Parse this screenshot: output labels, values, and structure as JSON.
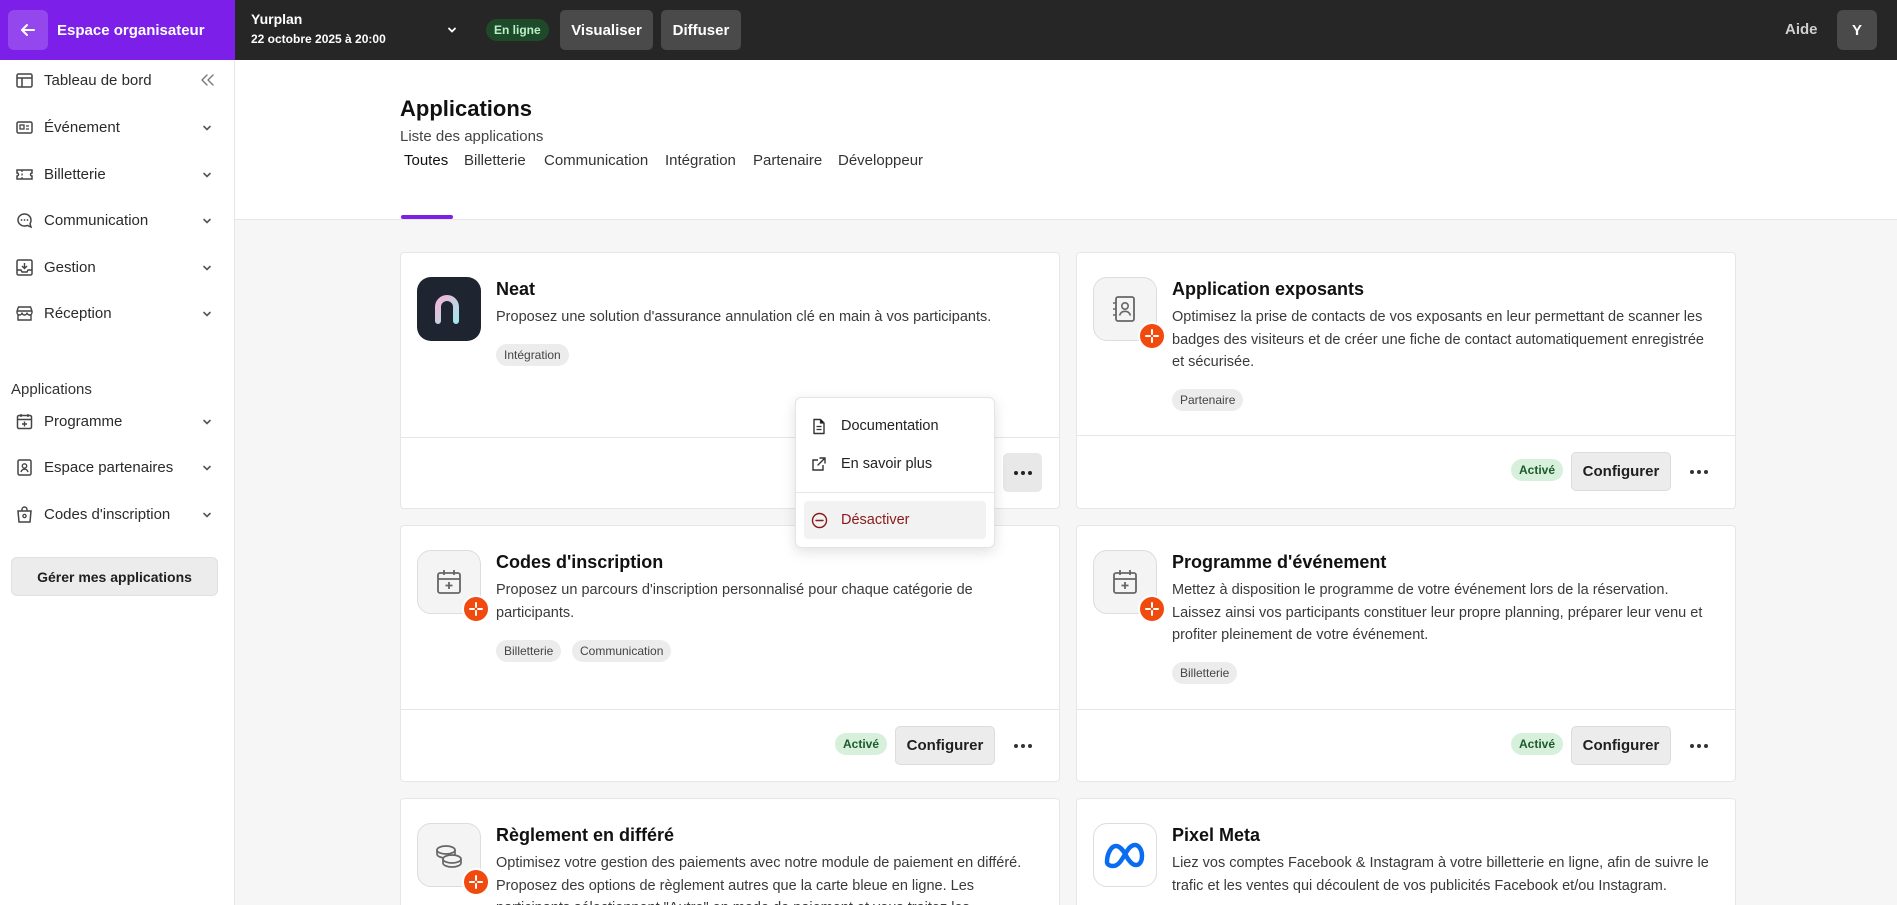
{
  "topbar": {
    "org_label": "Espace organisateur",
    "event_name": "Yurplan",
    "event_date": "22 octobre 2025 à 20:00",
    "status": "En ligne",
    "visualize": "Visualiser",
    "broadcast": "Diffuser",
    "help": "Aide",
    "avatar": "Y"
  },
  "sidebar": {
    "items": [
      {
        "label": "Tableau de bord",
        "icon": "dashboard-icon"
      },
      {
        "label": "Événement",
        "icon": "event-card-icon"
      },
      {
        "label": "Billetterie",
        "icon": "ticket-icon"
      },
      {
        "label": "Communication",
        "icon": "chat-icon"
      },
      {
        "label": "Gestion",
        "icon": "inbox-icon"
      },
      {
        "label": "Réception",
        "icon": "store-icon"
      }
    ],
    "section_title": "Applications",
    "app_items": [
      {
        "label": "Programme",
        "icon": "calendar-plus-icon"
      },
      {
        "label": "Espace partenaires",
        "icon": "contact-badge-icon"
      },
      {
        "label": "Codes d'inscription",
        "icon": "lock-bag-icon"
      }
    ],
    "manage_button": "Gérer mes applications"
  },
  "header": {
    "title": "Applications",
    "subtitle": "Liste des applications",
    "tabs": [
      "Toutes",
      "Billetterie",
      "Communication",
      "Intégration",
      "Partenaire",
      "Développeur"
    ],
    "active_tab": "Toutes"
  },
  "cards": [
    {
      "title": "Neat",
      "description": "Proposez une solution d'assurance annulation clé en main à vos participants.",
      "tags": [
        "Intégration"
      ]
    },
    {
      "title": "Application exposants",
      "description": "Optimisez la prise de contacts de vos exposants en leur permettant de scanner les badges des visiteurs et de créer une fiche de contact automatiquement enregistrée et sécurisée.",
      "tags": [
        "Partenaire"
      ],
      "status": "Activé",
      "configure": "Configurer"
    },
    {
      "title": "Codes d'inscription",
      "description": "Proposez un parcours d'inscription personnalisé pour chaque catégorie de participants.",
      "tags": [
        "Billetterie",
        "Communication"
      ],
      "status": "Activé",
      "configure": "Configurer"
    },
    {
      "title": "Programme d'événement",
      "description": "Mettez à disposition le programme de votre événement lors de la réservation. Laissez ainsi vos participants constituer leur propre planning, préparer leur venu et profiter pleinement de votre événement.",
      "tags": [
        "Billetterie"
      ],
      "status": "Activé",
      "configure": "Configurer"
    },
    {
      "title": "Règlement en différé",
      "description": "Optimisez votre gestion des paiements avec notre module de paiement en différé. Proposez des options de règlement autres que la carte bleue en ligne. Les participants sélectionnent \"Autre\" en mode de paiement et vous traitez les"
    },
    {
      "title": "Pixel Meta",
      "description": "Liez vos comptes Facebook & Instagram à votre billetterie en ligne, afin de suivre le trafic et les ventes qui découlent de vos publicités Facebook et/ou Instagram."
    }
  ],
  "dropdown": {
    "items": [
      "Documentation",
      "En savoir plus",
      "Désactiver"
    ]
  },
  "colors": {
    "brand": "#7c1fe8",
    "topbar": "#262626",
    "active_badge": "#d7f0db",
    "app_badge": "#f04a0f",
    "danger": "#8a1a1a"
  }
}
